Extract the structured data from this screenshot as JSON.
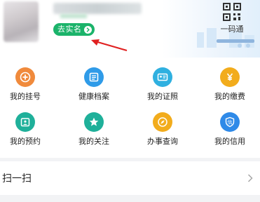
{
  "header": {
    "verify_label": "去实名",
    "qr_label": "一码通"
  },
  "services": [
    {
      "label": "我的挂号",
      "icon": "plus-icon",
      "color": "#f08a3c"
    },
    {
      "label": "健康档案",
      "icon": "document-icon",
      "color": "#2f9be8"
    },
    {
      "label": "我的证照",
      "icon": "id-card-icon",
      "color": "#2fb0e0"
    },
    {
      "label": "我的缴费",
      "icon": "yuan-icon",
      "color": "#f2ac1c"
    },
    {
      "label": "我的预约",
      "icon": "calendar-icon",
      "color": "#1fb09a"
    },
    {
      "label": "我的关注",
      "icon": "star-icon",
      "color": "#1fb09a"
    },
    {
      "label": "办事查询",
      "icon": "compass-icon",
      "color": "#f2ac1c"
    },
    {
      "label": "我的信用",
      "icon": "credit-icon",
      "color": "#2f8ae8"
    }
  ],
  "scan": {
    "label": "扫一扫"
  },
  "colors": {
    "accent_green": "#1bb36a",
    "annotation_red": "#e02020"
  }
}
